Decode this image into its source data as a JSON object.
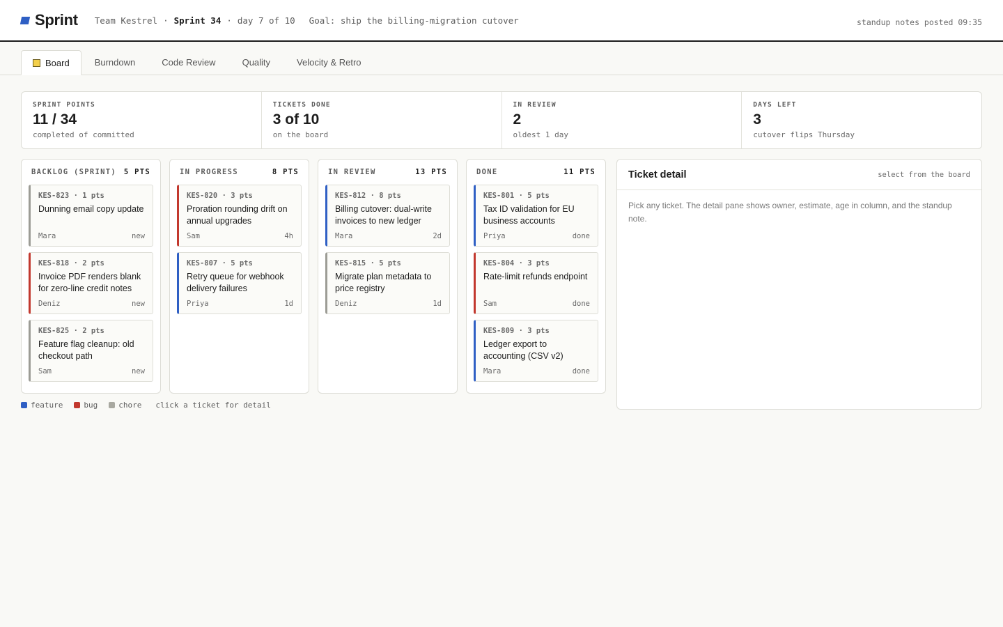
{
  "app": {
    "name": "Sprint",
    "team": "Team Kestrel",
    "sprint": "Sprint 34",
    "day": "day 7 of 10",
    "goal": "Goal: ship the billing-migration cutover",
    "posted": "standup notes posted 09:35",
    "separator": "·"
  },
  "tabs": [
    {
      "label": "Board",
      "active": true
    },
    {
      "label": "Burndown"
    },
    {
      "label": "Code Review"
    },
    {
      "label": "Quality"
    },
    {
      "label": "Velocity & Retro"
    }
  ],
  "stats": [
    {
      "label": "SPRINT POINTS",
      "value": "11 / 34",
      "sub": "completed of committed"
    },
    {
      "label": "TICKETS DONE",
      "value": "3 of 10",
      "sub": "on the board"
    },
    {
      "label": "IN REVIEW",
      "value": "2",
      "sub": "oldest 1 day"
    },
    {
      "label": "DAYS LEFT",
      "value": "3",
      "sub": "cutover flips Thursday"
    }
  ],
  "columns": [
    {
      "title": "BACKLOG (SPRINT)",
      "points": "5 PTS",
      "cards": [
        {
          "id": "KES-823 · 1 pts",
          "title": "Dunning email copy update",
          "owner": "Mara",
          "age": "new",
          "kind": "chore"
        },
        {
          "id": "KES-818 · 2 pts",
          "title": "Invoice PDF renders blank for zero-line credit notes",
          "owner": "Deniz",
          "age": "new",
          "kind": "bug"
        },
        {
          "id": "KES-825 · 2 pts",
          "title": "Feature flag cleanup: old checkout path",
          "owner": "Sam",
          "age": "new",
          "kind": "chore"
        }
      ]
    },
    {
      "title": "IN PROGRESS",
      "points": "8 PTS",
      "cards": [
        {
          "id": "KES-820 · 3 pts",
          "title": "Proration rounding drift on annual upgrades",
          "owner": "Sam",
          "age": "4h",
          "kind": "bug"
        },
        {
          "id": "KES-807 · 5 pts",
          "title": "Retry queue for webhook delivery failures",
          "owner": "Priya",
          "age": "1d",
          "kind": "feature"
        }
      ]
    },
    {
      "title": "IN REVIEW",
      "points": "13 PTS",
      "cards": [
        {
          "id": "KES-812 · 8 pts",
          "title": "Billing cutover: dual-write invoices to new ledger",
          "owner": "Mara",
          "age": "2d",
          "kind": "feature"
        },
        {
          "id": "KES-815 · 5 pts",
          "title": "Migrate plan metadata to price registry",
          "owner": "Deniz",
          "age": "1d",
          "kind": "chore"
        }
      ]
    },
    {
      "title": "DONE",
      "points": "11 PTS",
      "cards": [
        {
          "id": "KES-801 · 5 pts",
          "title": "Tax ID validation for EU business accounts",
          "owner": "Priya",
          "age": "done",
          "kind": "feature"
        },
        {
          "id": "KES-804 · 3 pts",
          "title": "Rate-limit refunds endpoint",
          "owner": "Sam",
          "age": "done",
          "kind": "bug"
        },
        {
          "id": "KES-809 · 3 pts",
          "title": "Ledger export to accounting (CSV v2)",
          "owner": "Mara",
          "age": "done",
          "kind": "feature"
        }
      ]
    }
  ],
  "legend": {
    "items": [
      {
        "label": "feature",
        "color": "#2f5fc4"
      },
      {
        "label": "bug",
        "color": "#c2382e"
      },
      {
        "label": "chore",
        "color": "#a8a8a0"
      }
    ],
    "note": "click a ticket for detail"
  },
  "detail": {
    "title": "Ticket detail",
    "hint": "select from the board",
    "body": "Pick any ticket. The detail pane shows owner, estimate, age in column, and the standup note."
  }
}
